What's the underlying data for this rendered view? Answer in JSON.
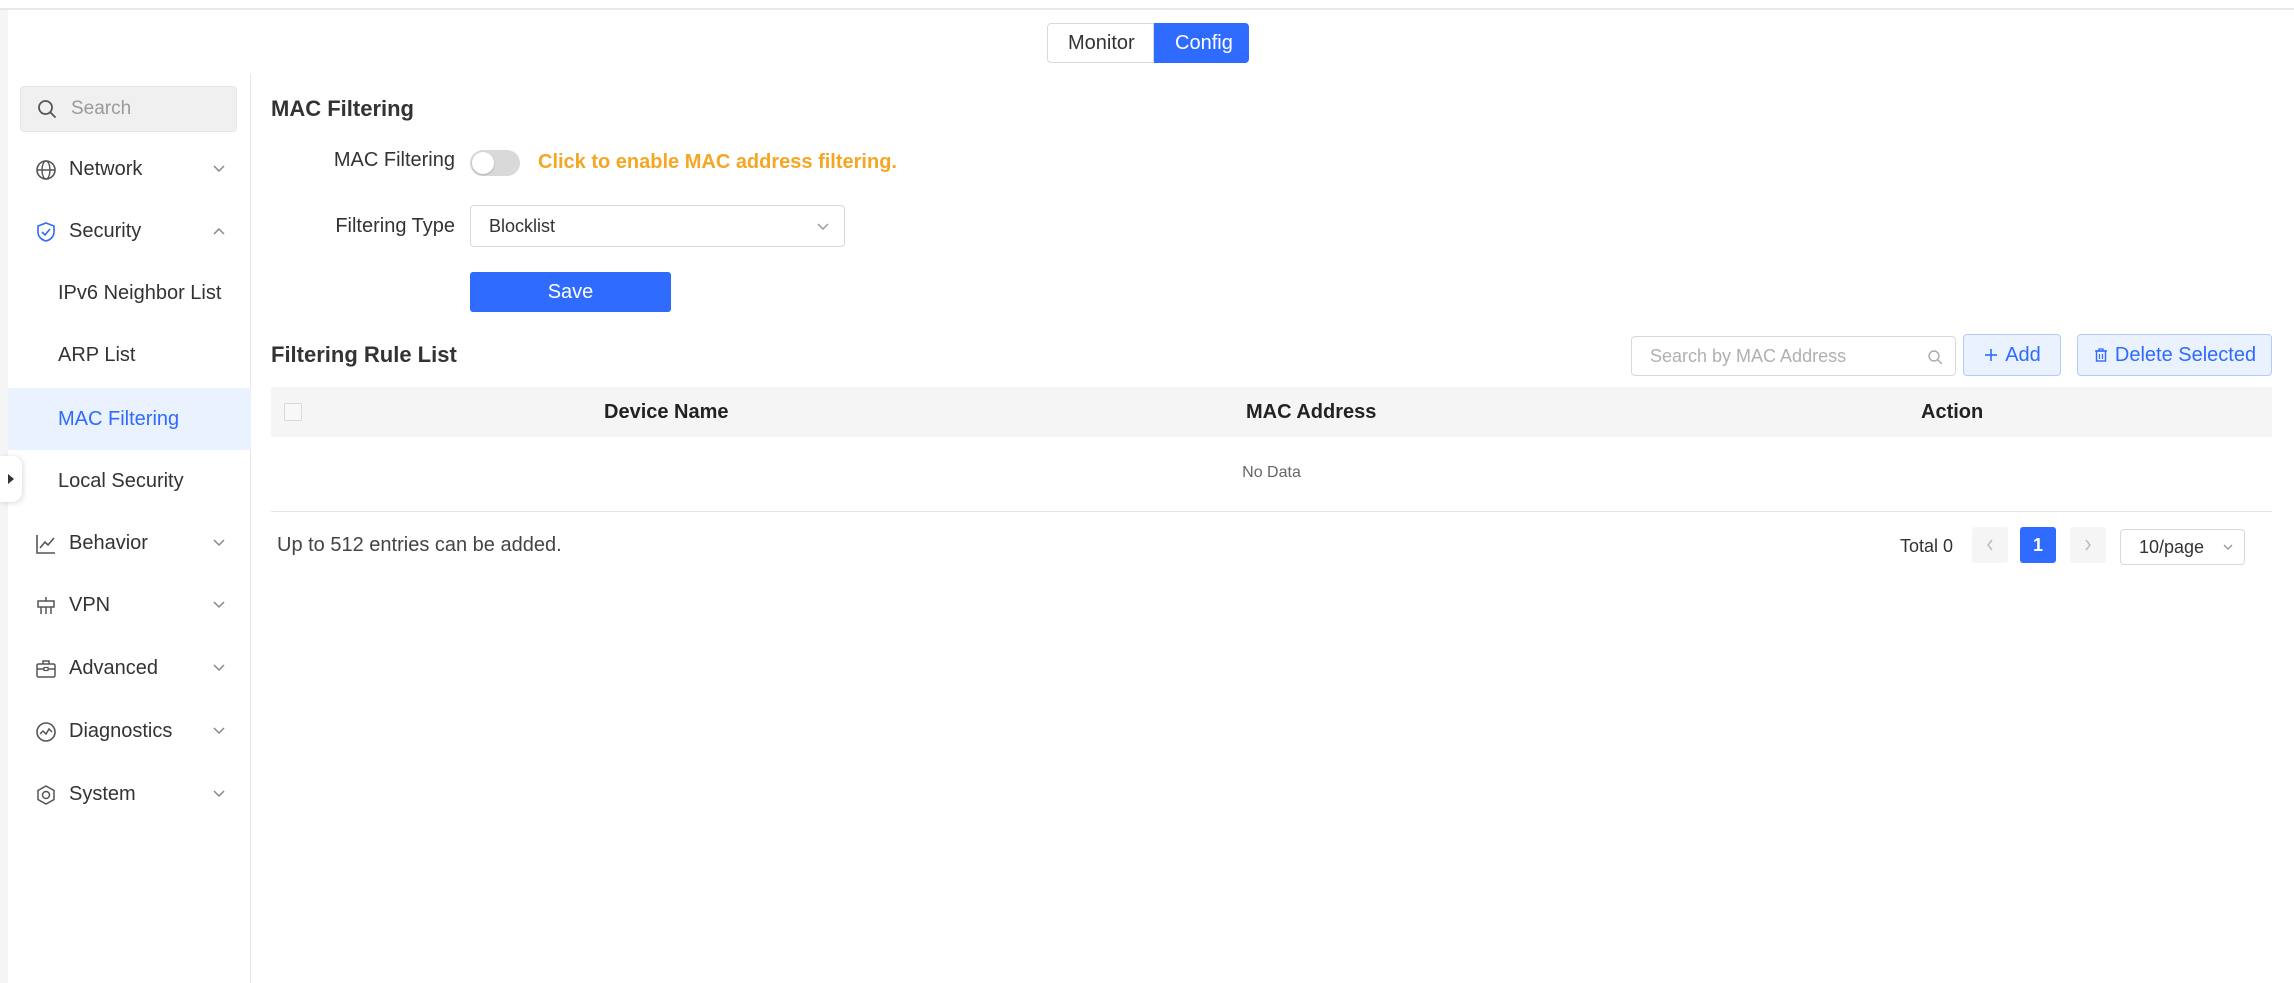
{
  "header": {
    "mode_tabs": [
      {
        "label": "Monitor",
        "active": false
      },
      {
        "label": "Config",
        "active": true
      }
    ]
  },
  "sidebar": {
    "search_placeholder": "Search",
    "items": [
      {
        "label": "Network",
        "icon": "globe-icon",
        "expanded": false
      },
      {
        "label": "Security",
        "icon": "shield-icon",
        "expanded": true,
        "children": [
          {
            "label": "IPv6 Neighbor List",
            "active": false
          },
          {
            "label": "ARP List",
            "active": false
          },
          {
            "label": "MAC Filtering",
            "active": true
          },
          {
            "label": "Local Security",
            "active": false
          }
        ]
      },
      {
        "label": "Behavior",
        "icon": "chart-icon",
        "expanded": false
      },
      {
        "label": "VPN",
        "icon": "vpn-icon",
        "expanded": false
      },
      {
        "label": "Advanced",
        "icon": "toolbox-icon",
        "expanded": false
      },
      {
        "label": "Diagnostics",
        "icon": "diagnostics-icon",
        "expanded": false
      },
      {
        "label": "System",
        "icon": "system-gear-icon",
        "expanded": false
      }
    ]
  },
  "main": {
    "title": "MAC Filtering",
    "form": {
      "mac_filtering_label": "MAC Filtering",
      "mac_filtering_enabled": false,
      "mac_filtering_hint": "Click to enable MAC address filtering.",
      "filtering_type_label": "Filtering Type",
      "filtering_type_value": "Blocklist",
      "save_label": "Save"
    },
    "rule_list": {
      "title": "Filtering Rule List",
      "search_placeholder": "Search by MAC Address",
      "add_label": "Add",
      "delete_label": "Delete Selected",
      "columns": [
        "Device Name",
        "MAC Address",
        "Action"
      ],
      "rows": [],
      "empty_text": "No Data",
      "footer_note": "Up to 512 entries can be added.",
      "total_text": "Total 0",
      "current_page": "1",
      "page_size": "10/page"
    }
  },
  "colors": {
    "accent": "#2f6bff",
    "warning": "#f5a623",
    "active_bg": "#eaf1ff"
  }
}
